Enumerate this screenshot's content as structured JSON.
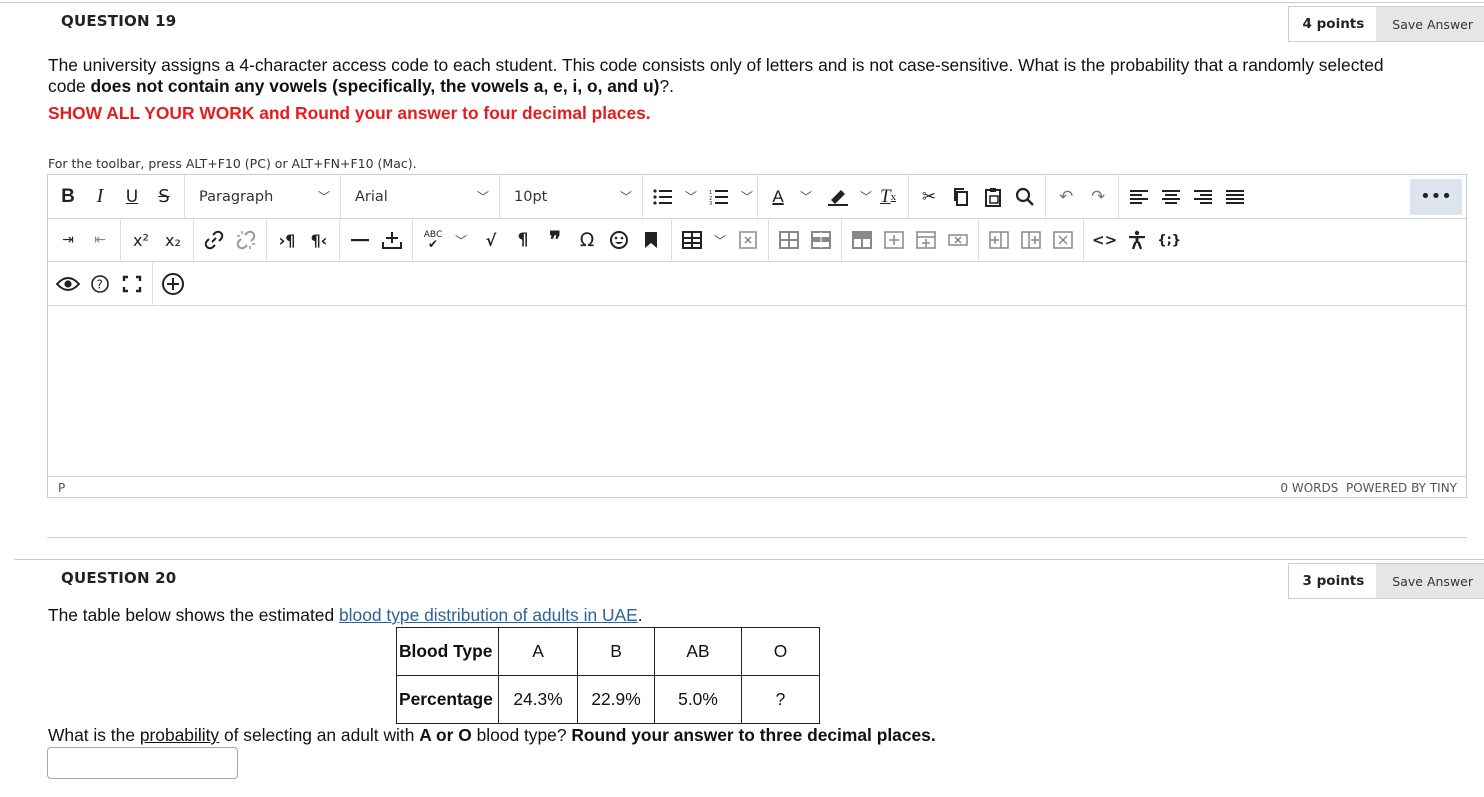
{
  "q19": {
    "title": "QUESTION 19",
    "points": "4 points",
    "save_label": "Save Answer",
    "text_1": "The university assigns a 4-character access code to each student. This code consists only of letters and is not case-sensitive. What is the probability that a randomly selected",
    "text_2_a": "code ",
    "text_2_b": "does not contain any vowels (specifically, the vowels a, e, i, o, and u)",
    "text_2_c": "?.",
    "instruction": "SHOW ALL YOUR WORK and Round your answer to four decimal places.",
    "kbd_hint": "For the toolbar, press ALT+F10 (PC) or ALT+FN+F10 (Mac).",
    "editor": {
      "paragraph_select": "Paragraph",
      "font_select": "Arial",
      "size_select": "10pt",
      "more_label": "•••",
      "status_path": "P",
      "status_words": "0 WORDS",
      "status_powered": "POWERED BY TINY",
      "row1_icons": [
        "bold-icon",
        "italic-icon",
        "underline-icon",
        "strikethrough-icon",
        "bullet-list-icon",
        "numbered-list-icon",
        "text-color-icon",
        "highlight-icon",
        "clear-formatting-icon",
        "cut-icon",
        "copy-icon",
        "paste-icon",
        "find-icon",
        "undo-icon",
        "redo-icon",
        "align-left-icon",
        "align-center-icon",
        "align-right-icon",
        "justify-icon"
      ],
      "row2_icons": [
        "indent-icon",
        "outdent-icon",
        "superscript-icon",
        "subscript-icon",
        "link-icon",
        "unlink-icon",
        "ltr-icon",
        "rtl-icon",
        "horizontal-line-icon",
        "plus-minus-icon",
        "spellcheck-icon",
        "math-icon",
        "paragraph-mark-icon",
        "blockquote-icon",
        "special-char-icon",
        "emoji-icon",
        "bookmark-icon",
        "table-icon",
        "table-delete-icon",
        "table-props-icon",
        "table-cell-props-icon",
        "row-props-icon",
        "insert-row-before-icon",
        "insert-row-after-icon",
        "delete-row-icon",
        "insert-col-before-icon",
        "insert-col-after-icon",
        "delete-col-icon",
        "source-code-icon",
        "accessibility-icon",
        "template-icon"
      ],
      "row3_icons": [
        "preview-icon",
        "help-icon",
        "fullscreen-icon",
        "add-content-icon"
      ]
    }
  },
  "q20": {
    "title": "QUESTION 20",
    "points": "3 points",
    "save_label": "Save Answer",
    "intro_a": "The table below shows the estimated ",
    "intro_link": "blood type distribution of adults in UAE",
    "intro_c": ".",
    "table": {
      "header_label": "Blood Type",
      "row_label": "Percentage",
      "columns": [
        "A",
        "B",
        "AB",
        "O"
      ],
      "values": [
        "24.3%",
        "22.9%",
        "5.0%",
        "?"
      ]
    },
    "question_a": "What is the ",
    "question_link": "probability",
    "question_b": " of selecting an adult with ",
    "question_bold": "A or O",
    "question_c": " blood type? ",
    "question_bold2": "Round your answer to three decimal places.",
    "answer_value": ""
  },
  "colors": {
    "instruction_red": "#e41e1e",
    "link_blue": "#2a6496",
    "save_button_bg": "#e6e6e6",
    "more_button_bg": "#dde4ee"
  }
}
